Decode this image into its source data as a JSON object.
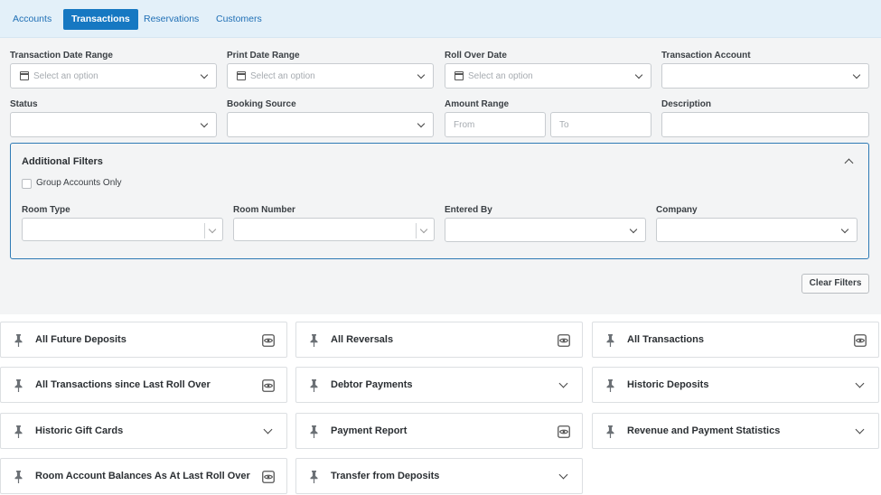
{
  "tabs": [
    {
      "label": "Accounts"
    },
    {
      "label": "Transactions"
    },
    {
      "label": "Reservations"
    },
    {
      "label": "Customers"
    }
  ],
  "filters": {
    "transaction_date_range": {
      "label": "Transaction Date Range",
      "placeholder": "Select an option"
    },
    "print_date_range": {
      "label": "Print Date Range",
      "placeholder": "Select an option"
    },
    "roll_over_date": {
      "label": "Roll Over Date",
      "placeholder": "Select an option"
    },
    "transaction_account": {
      "label": "Transaction Account",
      "value": ""
    },
    "status": {
      "label": "Status",
      "value": ""
    },
    "booking_source": {
      "label": "Booking Source",
      "value": ""
    },
    "amount_range": {
      "label": "Amount Range",
      "from_placeholder": "From",
      "to_placeholder": "To"
    },
    "description": {
      "label": "Description",
      "value": ""
    }
  },
  "additional_filters": {
    "title": "Additional Filters",
    "group_accounts_only": {
      "label": "Group Accounts Only",
      "checked": false
    },
    "room_type": {
      "label": "Room Type",
      "value": ""
    },
    "room_number": {
      "label": "Room Number",
      "value": ""
    },
    "entered_by": {
      "label": "Entered By",
      "value": ""
    },
    "company": {
      "label": "Company",
      "value": ""
    }
  },
  "clear_filters_label": "Clear Filters",
  "reports": [
    {
      "title": "All Future Deposits",
      "icon": "eye-icon"
    },
    {
      "title": "All Reversals",
      "icon": "eye-icon"
    },
    {
      "title": "All Transactions",
      "icon": "eye-icon"
    },
    {
      "title": "All Transactions since Last Roll Over",
      "icon": "eye-icon"
    },
    {
      "title": "Debtor Payments",
      "icon": "chevron-down-icon"
    },
    {
      "title": "Historic Deposits",
      "icon": "chevron-down-icon"
    },
    {
      "title": "Historic Gift Cards",
      "icon": "chevron-down-icon"
    },
    {
      "title": "Payment Report",
      "icon": "eye-icon"
    },
    {
      "title": "Revenue and Payment Statistics",
      "icon": "chevron-down-icon"
    },
    {
      "title": "Room Account Balances As At Last Roll Over",
      "icon": "eye-icon"
    },
    {
      "title": "Transfer from Deposits",
      "icon": "chevron-down-icon"
    }
  ],
  "colors": {
    "accent": "#1678c2",
    "tabbar_bg": "#e3f0f9",
    "panel_border": "#2e7ab5",
    "filter_bg": "#f3f4f5"
  }
}
